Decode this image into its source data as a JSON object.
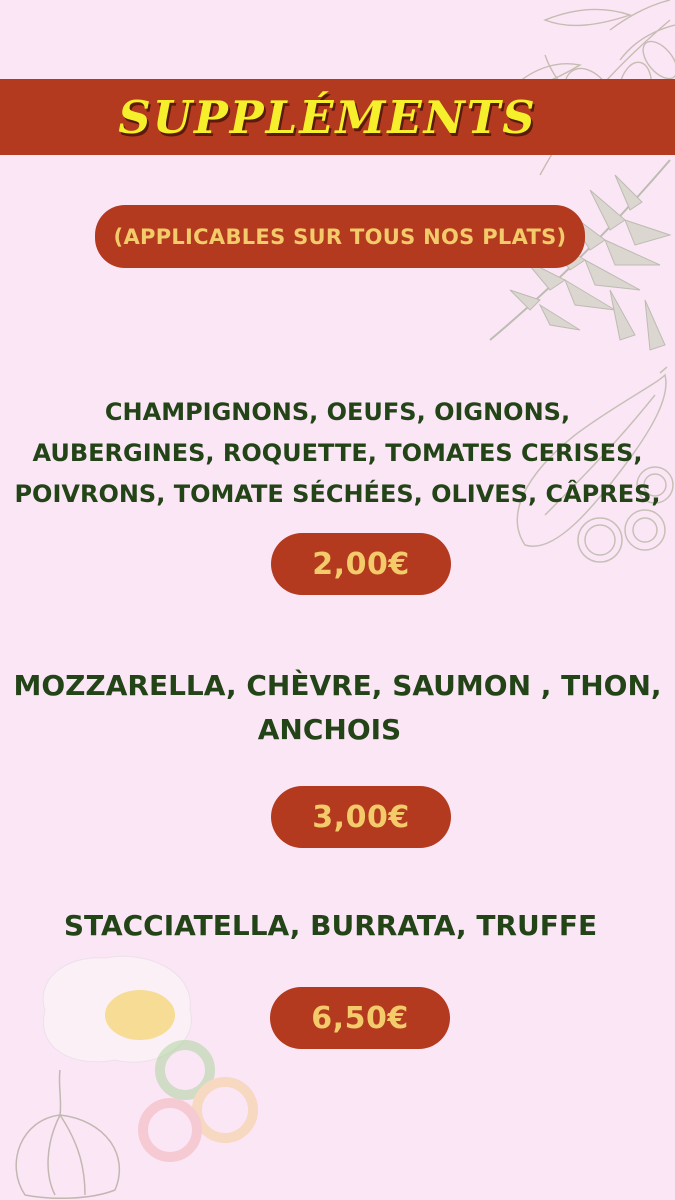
{
  "title": "SUPPLÉMENTS",
  "subtitle": "(APPLICABLES SUR TOUS NOS PLATS)",
  "groups": [
    {
      "lines": [
        "CHAMPIGNONS, OEUFS, OIGNONS,",
        "AUBERGINES, ROQUETTE, TOMATES CERISES,",
        "POIVRONS, TOMATE SÉCHÉES, OLIVES, CÂPRES,"
      ],
      "price": "2,00€"
    },
    {
      "lines": [
        "MOZZARELLA, CHÈVRE, SAUMON , THON,",
        "ANCHOIS"
      ],
      "price": "3,00€"
    },
    {
      "lines": [
        "STACCIATELLA, BURRATA, TRUFFE"
      ],
      "price": "6,50€"
    }
  ],
  "colors": {
    "background": "#fbe6f6",
    "accent_red": "#b33a1e",
    "title_yellow": "#f6ef2b",
    "pill_text_gold": "#f4cb6a",
    "item_text_green": "#234417"
  },
  "decorations": [
    "olive-branch-icon",
    "rosemary-icon",
    "zucchini-icon",
    "egg-icon",
    "pepper-rings-icon",
    "garlic-icon"
  ]
}
